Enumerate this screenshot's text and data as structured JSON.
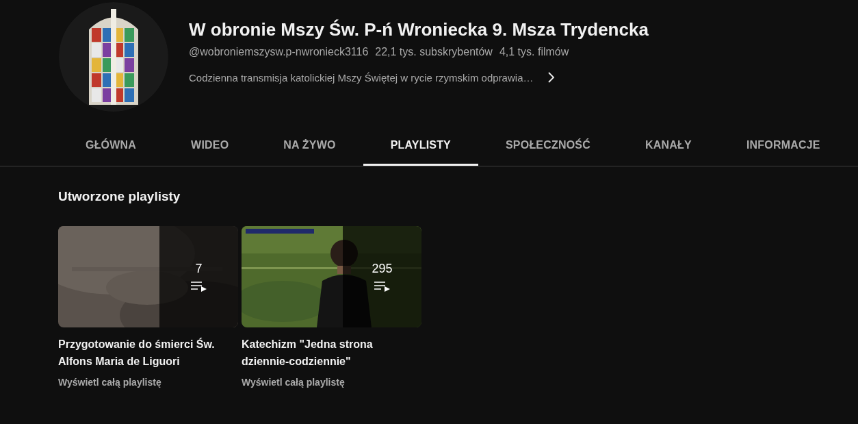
{
  "channel": {
    "title": "W obronie Mszy Św. P-ń Wroniecka 9. Msza Trydencka",
    "handle": "@wobroniemszysw.p-nwronieck3116",
    "subscribers": "22,1 tys. subskrybentów",
    "videos": "4,1 tys. filmów",
    "description": "Codzienna transmisja katolickiej Mszy Świętej w rycie rzymskim odprawia…"
  },
  "tabs": [
    {
      "label": "GŁÓWNA",
      "selected": false
    },
    {
      "label": "WIDEO",
      "selected": false
    },
    {
      "label": "NA ŻYWO",
      "selected": false
    },
    {
      "label": "PLAYLISTY",
      "selected": true
    },
    {
      "label": "SPOŁECZNOŚĆ",
      "selected": false
    },
    {
      "label": "KANAŁY",
      "selected": false
    },
    {
      "label": "INFORMACJE",
      "selected": false
    }
  ],
  "section_title": "Utworzone playlisty",
  "playlists": [
    {
      "title": "Przygotowanie do śmierci Św. Alfons Maria de Liguori",
      "count": "7",
      "link": "Wyświetl całą playlistę"
    },
    {
      "title": "Katechizm \"Jedna strona dziennie-codziennie\"",
      "count": "295",
      "link": "Wyświetl całą playlistę"
    }
  ]
}
